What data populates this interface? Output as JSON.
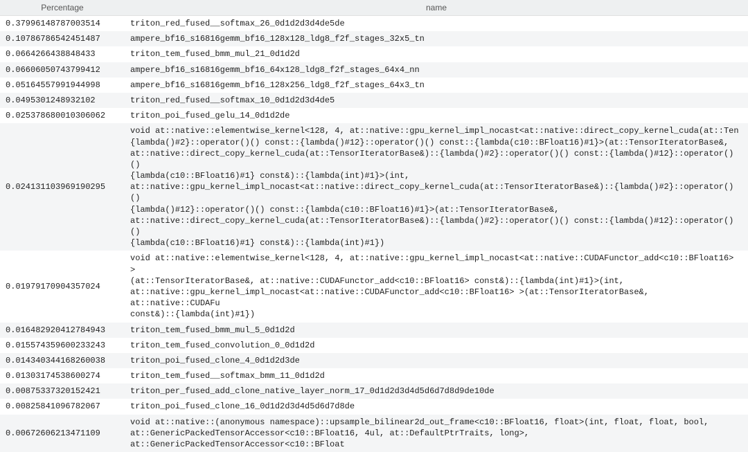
{
  "columns": {
    "percentage": "Percentage",
    "name": "name"
  },
  "rows": [
    {
      "percentage": "0.37996148787003514",
      "name": "triton_red_fused__softmax_26_0d1d2d3d4de5de"
    },
    {
      "percentage": "0.10786786542451487",
      "name": "ampere_bf16_s16816gemm_bf16_128x128_ldg8_f2f_stages_32x5_tn"
    },
    {
      "percentage": "0.0664266438848433",
      "name": "triton_tem_fused_bmm_mul_21_0d1d2d"
    },
    {
      "percentage": "0.06606050743799412",
      "name": "ampere_bf16_s16816gemm_bf16_64x128_ldg8_f2f_stages_64x4_nn"
    },
    {
      "percentage": "0.05164557991944998",
      "name": "ampere_bf16_s16816gemm_bf16_128x256_ldg8_f2f_stages_64x3_tn"
    },
    {
      "percentage": "0.0495301248932102",
      "name": "triton_red_fused__softmax_10_0d1d2d3d4de5"
    },
    {
      "percentage": "0.025378680010306062",
      "name": "triton_poi_fused_gelu_14_0d1d2de"
    },
    {
      "percentage": "0.024131103969190295",
      "name": "void at::native::elementwise_kernel<128, 4, at::native::gpu_kernel_impl_nocast<at::native::direct_copy_kernel_cuda(at::Ten\n{lambda()#2}::operator()() const::{lambda()#12}::operator()() const::{lambda(c10::BFloat16)#1}>(at::TensorIteratorBase&,\nat::native::direct_copy_kernel_cuda(at::TensorIteratorBase&)::{lambda()#2}::operator()() const::{lambda()#12}::operator()()\n{lambda(c10::BFloat16)#1} const&)::{lambda(int)#1}>(int,\nat::native::gpu_kernel_impl_nocast<at::native::direct_copy_kernel_cuda(at::TensorIteratorBase&)::{lambda()#2}::operator()()\n{lambda()#12}::operator()() const::{lambda(c10::BFloat16)#1}>(at::TensorIteratorBase&,\nat::native::direct_copy_kernel_cuda(at::TensorIteratorBase&)::{lambda()#2}::operator()() const::{lambda()#12}::operator()()\n{lambda(c10::BFloat16)#1} const&)::{lambda(int)#1})"
    },
    {
      "percentage": "0.01979170904357024",
      "name": "void at::native::elementwise_kernel<128, 4, at::native::gpu_kernel_impl_nocast<at::native::CUDAFunctor_add<c10::BFloat16> >\n(at::TensorIteratorBase&, at::native::CUDAFunctor_add<c10::BFloat16> const&)::{lambda(int)#1}>(int,\nat::native::gpu_kernel_impl_nocast<at::native::CUDAFunctor_add<c10::BFloat16> >(at::TensorIteratorBase&, at::native::CUDAFu\nconst&)::{lambda(int)#1})"
    },
    {
      "percentage": "0.016482920412784943",
      "name": "triton_tem_fused_bmm_mul_5_0d1d2d"
    },
    {
      "percentage": "0.015574359600233243",
      "name": "triton_tem_fused_convolution_0_0d1d2d"
    },
    {
      "percentage": "0.014340344168260038",
      "name": "triton_poi_fused_clone_4_0d1d2d3de"
    },
    {
      "percentage": "0.01303174538600274",
      "name": "triton_tem_fused__softmax_bmm_11_0d1d2d"
    },
    {
      "percentage": "0.00875337320152421",
      "name": "triton_per_fused_add_clone_native_layer_norm_17_0d1d2d3d4d5d6d7d8d9de10de"
    },
    {
      "percentage": "0.00825841096782067",
      "name": "triton_poi_fused_clone_16_0d1d2d3d4d5d6d7d8de"
    },
    {
      "percentage": "0.00672606213471109",
      "name": "void at::native::(anonymous namespace)::upsample_bilinear2d_out_frame<c10::BFloat16, float>(int, float, float, bool,\nat::GenericPackedTensorAccessor<c10::BFloat16, 4ul, at::DefaultPtrTraits, long>, at::GenericPackedTensorAccessor<c10::BFloat"
    }
  ]
}
